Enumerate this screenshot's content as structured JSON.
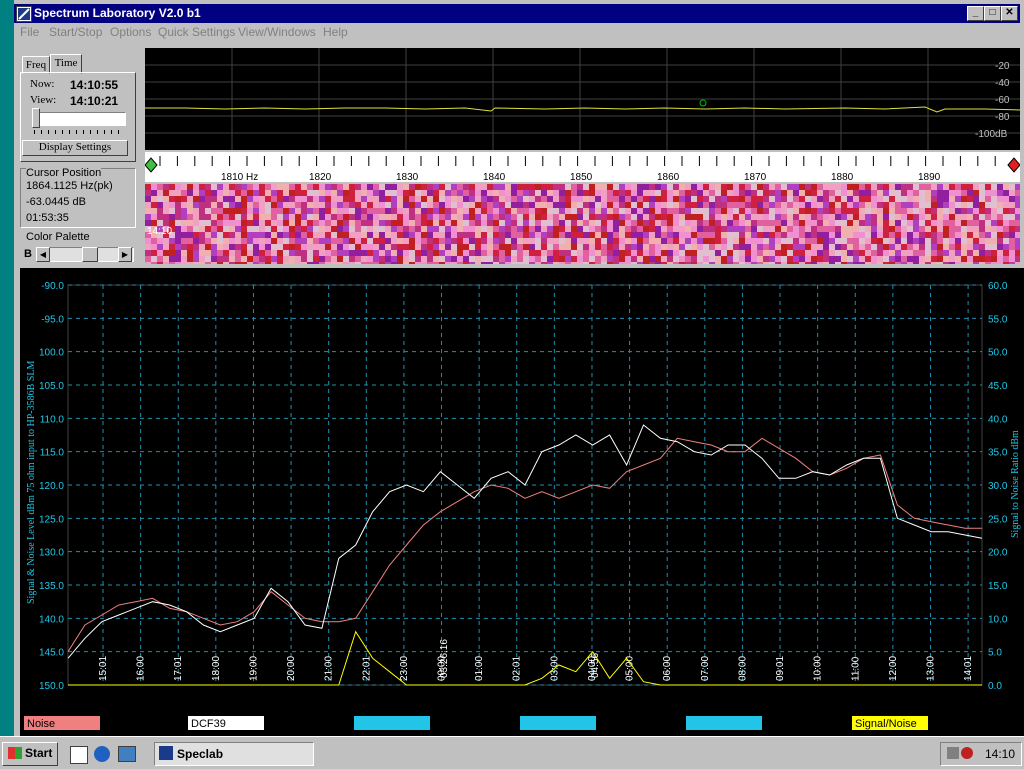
{
  "window": {
    "title": "Spectrum Laboratory V2.0 b1"
  },
  "menu": [
    "File",
    "Start/Stop",
    "Options",
    "Quick Settings",
    "View/Windows",
    "Help"
  ],
  "left_panel": {
    "tabs": [
      "Freq",
      "Time"
    ],
    "now_label": "Now:",
    "now_value": "14:10:55",
    "view_label": "View:",
    "view_value": "14:10:21",
    "display_settings": "Display Settings",
    "cursor_position_label": "Cursor Position",
    "cursor_freq": "1864.1125 Hz(pk)",
    "cursor_level": "-63.0445 dB",
    "cursor_time": "01:53:35",
    "color_palette_label": "Color Palette",
    "palette_b": "B"
  },
  "spectrum": {
    "db_ticks": [
      "-20",
      "-40",
      "-60",
      "-80",
      "-100dB"
    ],
    "freq_ticks": [
      "1810 Hz",
      "1820",
      "1830",
      "1840",
      "1850",
      "1860",
      "1870",
      "1880",
      "1890"
    ],
    "waterfall_time": "14:10"
  },
  "chart_data": {
    "type": "line",
    "ylabel": "Signal & Noise Level dBm 75 ohm input to HP-3586B SLM",
    "y2label": "Signal to Noise Ratio  dBm",
    "ylim": [
      -150,
      -90
    ],
    "y2lim": [
      0,
      60
    ],
    "y_ticks": [
      "-90.0",
      "-95.0",
      "100.0",
      "105.0",
      "110.0",
      "115.0",
      "120.0",
      "125.0",
      "130.0",
      "135.0",
      "140.0",
      "145.0",
      "150.0"
    ],
    "y2_ticks": [
      "60.0",
      "55.0",
      "50.0",
      "45.0",
      "40.0",
      "35.0",
      "30.0",
      "25.0",
      "20.0",
      "15.0",
      "10.0",
      "5.0",
      "0.0"
    ],
    "x_ticks": [
      "15:01",
      "16:00",
      "17:01",
      "18:00",
      "19:00",
      "20:00",
      "21:00",
      "22:01",
      "23:00",
      "00:00",
      "01:00",
      "02:01",
      "03:00",
      "04:00",
      "05:00",
      "06:00",
      "07:00",
      "08:00",
      "09:01",
      "10:00",
      "11:00",
      "12:00",
      "13:00",
      "14:01"
    ],
    "annotations": [
      "03:26:16",
      "04:56"
    ],
    "series": [
      {
        "name": "Noise",
        "color": "#f08080",
        "values": [
          -145,
          -141,
          -139.5,
          -138,
          -137.5,
          -137,
          -138.5,
          -139,
          -140,
          -141,
          -140.5,
          -139,
          -136,
          -138,
          -140,
          -140.5,
          -140.5,
          -140,
          -136,
          -132,
          -129,
          -126,
          -124,
          -122.5,
          -121,
          -120,
          -120.5,
          -122,
          -121,
          -122,
          -121,
          -120,
          -120.5,
          -118,
          -117,
          -116,
          -113,
          -113.5,
          -114,
          -115,
          -115,
          -113,
          -114.5,
          -116,
          -118,
          -118.5,
          -117.5,
          -116,
          -115.5,
          -123,
          -125,
          -125.5,
          -126,
          -126.5,
          -126.5
        ]
      },
      {
        "name": "DCF39",
        "color": "#ffffff",
        "values": [
          -146,
          -143,
          -140.5,
          -139.5,
          -138.5,
          -137.5,
          -138,
          -139,
          -141,
          -142,
          -141,
          -140,
          -135.5,
          -137.5,
          -141,
          -141.5,
          -131,
          -129,
          -124,
          -121,
          -120,
          -121,
          -118,
          -120,
          -122,
          -119,
          -118,
          -120,
          -115,
          -114,
          -112.5,
          -114,
          -112.5,
          -117,
          -111,
          -113,
          -113.5,
          -115,
          -115.5,
          -114,
          -114,
          -116,
          -119,
          -119,
          -118,
          -118.5,
          -117,
          -116,
          -116,
          -125,
          -126,
          -127,
          -127,
          -127.5,
          -128
        ]
      },
      {
        "name": "Signal/Noise",
        "color": "#ffff00",
        "values": [
          0,
          0,
          0,
          0,
          0,
          0,
          0,
          0,
          0,
          0,
          0,
          0,
          0,
          0,
          0,
          0,
          0,
          8,
          4,
          2,
          0,
          0,
          0,
          0,
          0,
          0,
          0,
          0,
          1,
          3,
          2,
          5,
          1,
          4,
          0.5,
          0,
          0,
          0,
          0,
          0,
          0,
          0,
          0,
          0,
          0,
          0,
          0,
          0,
          0,
          0,
          0,
          0,
          0,
          0,
          0
        ]
      }
    ],
    "legend": [
      "Noise",
      "DCF39",
      "",
      "",
      "",
      "Signal/Noise"
    ],
    "legend_colors": [
      "#f08080",
      "#ffffff",
      "#22c4e8",
      "#22c4e8",
      "#22c4e8",
      "#ffff00"
    ]
  },
  "taskbar": {
    "start": "Start",
    "task": "Speclab",
    "clock": "14:10"
  }
}
